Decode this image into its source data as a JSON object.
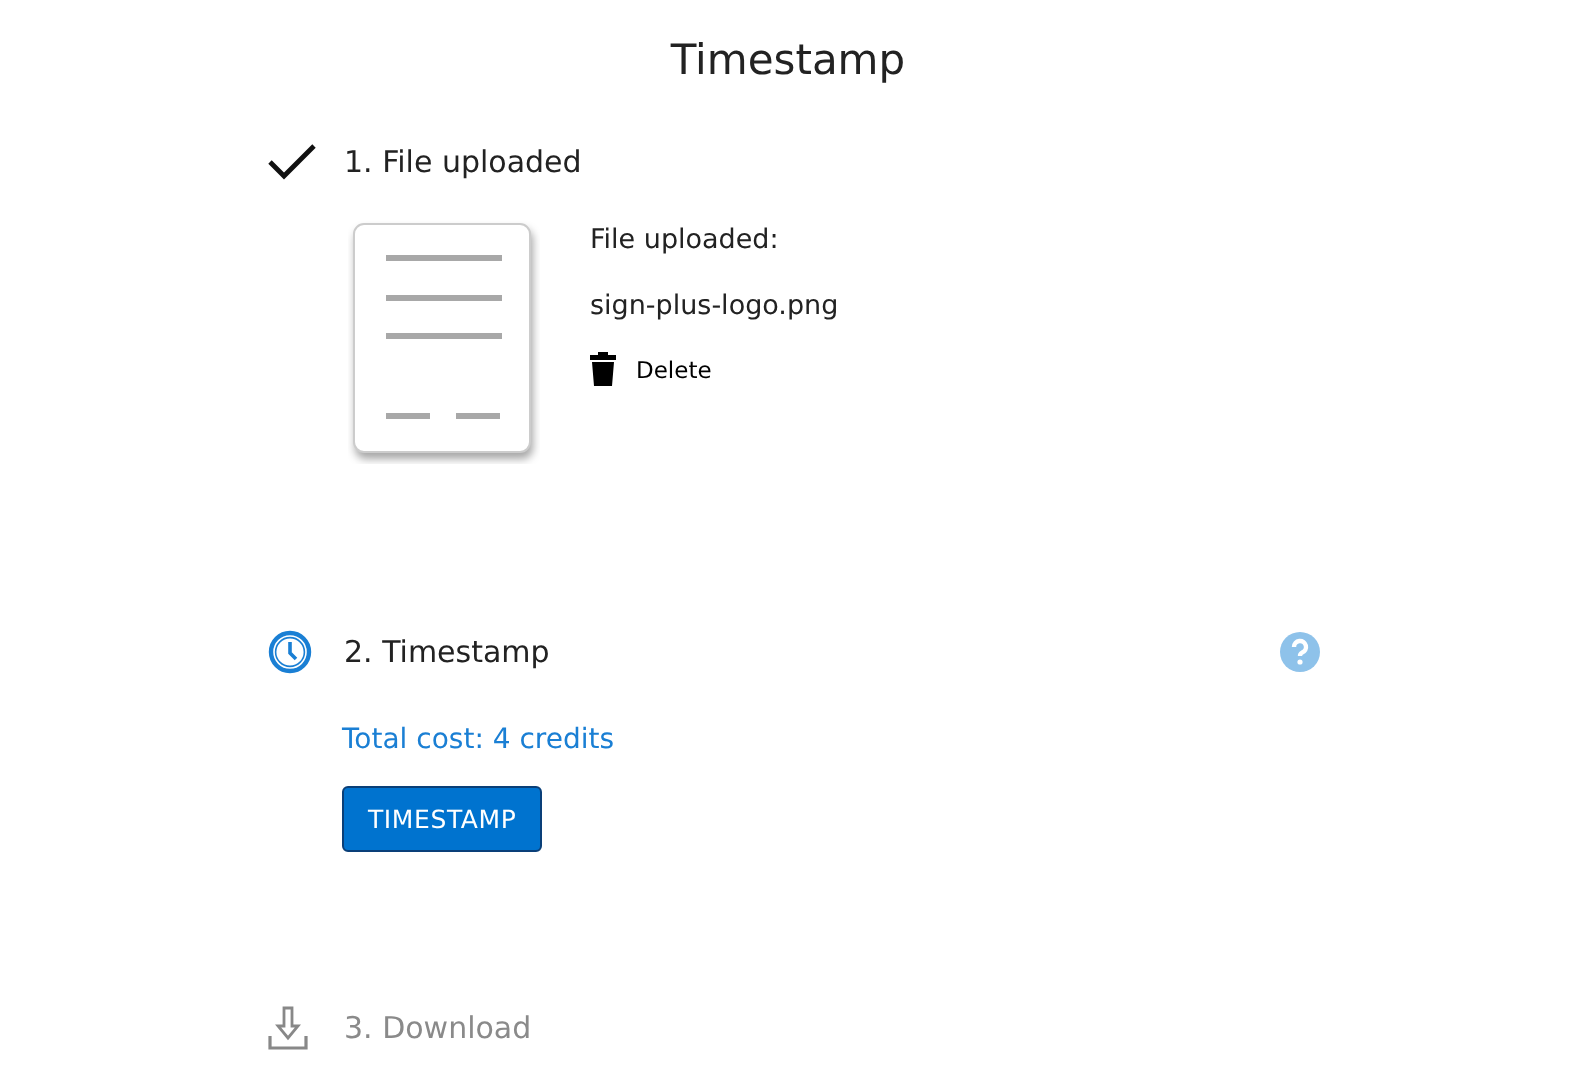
{
  "title": "Timestamp",
  "steps": [
    {
      "label": "1. File uploaded",
      "kind": "done",
      "help": false,
      "file": {
        "heading": "File uploaded:",
        "name": "sign-plus-logo.png",
        "delete_label": "Delete"
      }
    },
    {
      "label": "2. Timestamp",
      "kind": "active",
      "help": true,
      "cost": "Total cost: 4 credits",
      "button": "TIMESTAMP"
    },
    {
      "label": "3. Download",
      "kind": "pending",
      "help": false
    }
  ]
}
